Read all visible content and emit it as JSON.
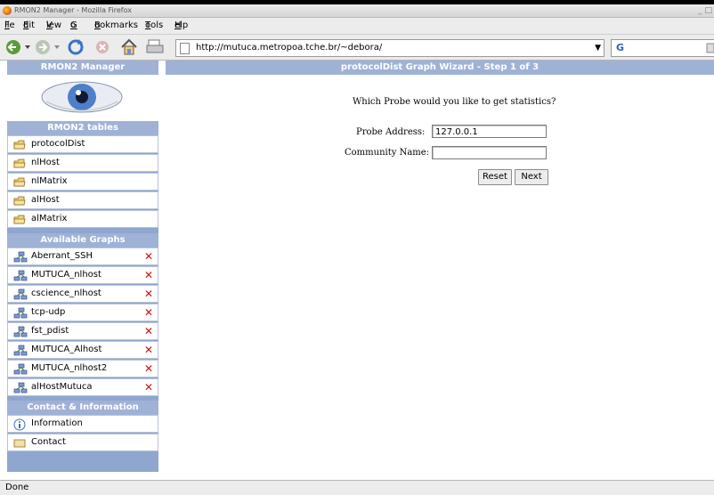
{
  "window": {
    "title": "RMON2 Manager - Mozilla Firefox",
    "controls": "_ □"
  },
  "menu": [
    {
      "label": "File",
      "u": "F",
      "rest": "ile"
    },
    {
      "label": "Edit",
      "u": "E",
      "rest": "dit"
    },
    {
      "label": "View",
      "u": "V",
      "rest": "iew"
    },
    {
      "label": "Go",
      "u": "G",
      "rest": "o"
    },
    {
      "label": "Bookmarks",
      "u": "B",
      "rest": "ookmarks"
    },
    {
      "label": "Tools",
      "u": "T",
      "rest": "ools"
    },
    {
      "label": "Help",
      "u": "H",
      "rest": "elp"
    }
  ],
  "nav": {
    "url": "http://mutuca.metropoa.tche.br/~debora/",
    "search_glyph": "G"
  },
  "sidebar": {
    "title": "RMON2 Manager",
    "tables_header": "RMON2 tables",
    "tables": [
      "protocolDist",
      "nlHost",
      "nlMatrix",
      "alHost",
      "alMatrix"
    ],
    "graphs_header": "Available Graphs",
    "graphs": [
      "Aberrant_SSH",
      "MUTUCA_nlhost",
      "cscience_nlhost",
      "tcp-udp",
      "fst_pdist",
      "MUTUCA_Alhost",
      "MUTUCA_nlhost2",
      "alHostMutuca"
    ],
    "delete_glyph": "✕",
    "contact_header": "Contact & Information",
    "contact": [
      "Information",
      "Contact"
    ]
  },
  "main": {
    "title": "protocolDist Graph Wizard - Step 1 of 3",
    "question": "Which Probe would you like to get statistics?",
    "probe_label": "Probe Address:",
    "probe_value": "127.0.0.1",
    "community_label": "Community Name:",
    "community_value": "",
    "reset": "Reset",
    "next": "Next"
  },
  "status": "Done",
  "colors": {
    "sidebar": "#8fa6cf",
    "header": "#9fb2d6",
    "delete": "#d01010"
  }
}
